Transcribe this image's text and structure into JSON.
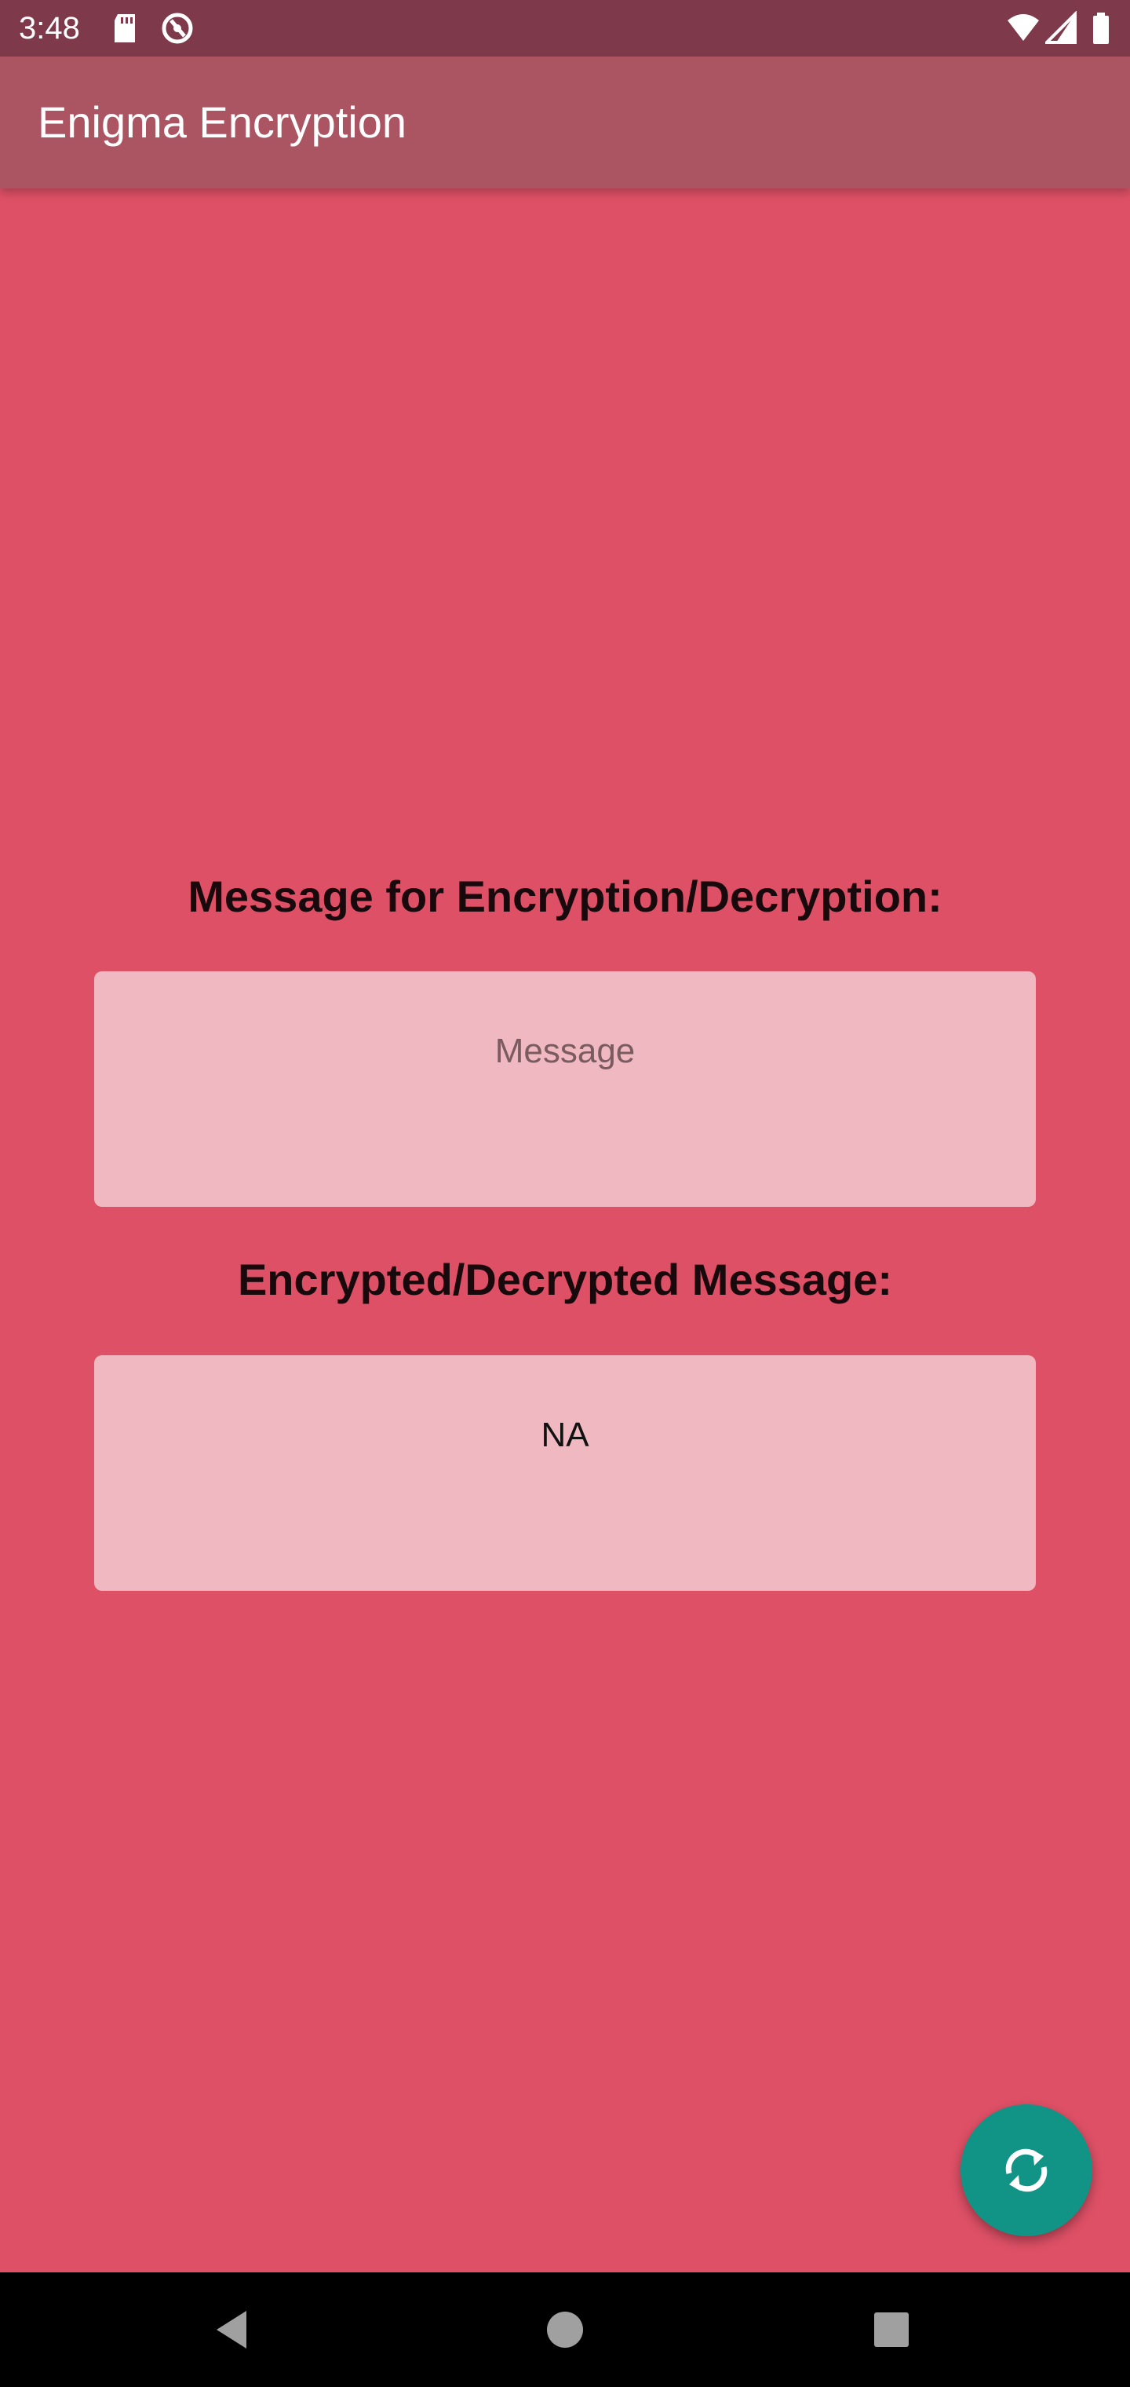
{
  "status_bar": {
    "time": "3:48",
    "left_icons": [
      "sd-card-icon",
      "no-disturb-icon"
    ],
    "right_icons": [
      "wifi-icon",
      "cell-signal-icon",
      "battery-icon"
    ]
  },
  "app_bar": {
    "title": "Enigma Encryption"
  },
  "main": {
    "input_label": "Message for Encryption/Decryption:",
    "input_placeholder": "Message",
    "input_value": "",
    "output_label": "Encrypted/Decrypted Message:",
    "output_value": "NA"
  },
  "fab": {
    "icon": "sync-icon"
  },
  "nav_bar": {
    "buttons": [
      "back-icon",
      "home-icon",
      "recents-icon"
    ]
  },
  "colors": {
    "status_bar": "#7e3a4a",
    "app_bar": "#ab5462",
    "background": "#de5066",
    "field": "#f0b8c1",
    "fab": "#119486"
  }
}
